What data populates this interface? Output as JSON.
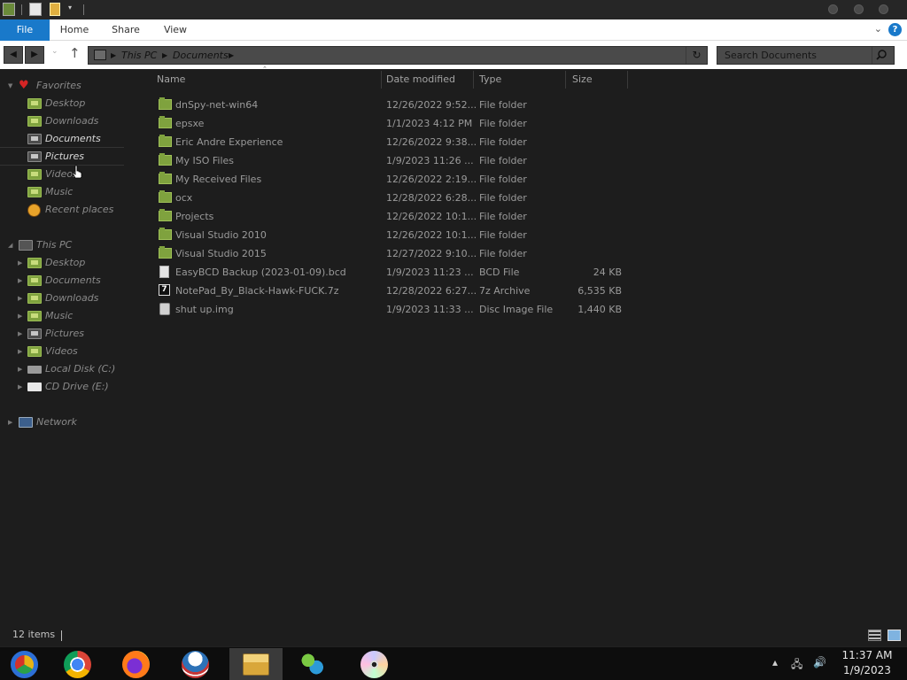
{
  "ribbon": {
    "tabs": [
      "File",
      "Home",
      "Share",
      "View"
    ]
  },
  "address": {
    "crumbs": [
      "This PC",
      "Documents"
    ]
  },
  "search": {
    "placeholder": "Search Documents"
  },
  "navpane": {
    "favorites_label": "Favorites",
    "favorites": [
      "Desktop",
      "Downloads",
      "Documents",
      "Pictures",
      "Videos",
      "Music",
      "Recent places"
    ],
    "thispc_label": "This PC",
    "thispc": [
      "Desktop",
      "Documents",
      "Downloads",
      "Music",
      "Pictures",
      "Videos",
      "Local Disk (C:)",
      "CD Drive (E:)"
    ],
    "network_label": "Network"
  },
  "columns": {
    "name": "Name",
    "date": "Date modified",
    "type": "Type",
    "size": "Size"
  },
  "files": [
    {
      "name": "dnSpy-net-win64",
      "date": "12/26/2022 9:52...",
      "type": "File folder",
      "size": "",
      "icon": "folder-icon"
    },
    {
      "name": "epsxe",
      "date": "1/1/2023 4:12 PM",
      "type": "File folder",
      "size": "",
      "icon": "folder-icon"
    },
    {
      "name": "Eric Andre Experience",
      "date": "12/26/2022 9:38...",
      "type": "File folder",
      "size": "",
      "icon": "folder-icon"
    },
    {
      "name": "My ISO Files",
      "date": "1/9/2023 11:26 ...",
      "type": "File folder",
      "size": "",
      "icon": "folder-icon"
    },
    {
      "name": "My Received Files",
      "date": "12/26/2022 2:19...",
      "type": "File folder",
      "size": "",
      "icon": "folder-icon"
    },
    {
      "name": "ocx",
      "date": "12/28/2022 6:28...",
      "type": "File folder",
      "size": "",
      "icon": "folder-icon"
    },
    {
      "name": "Projects",
      "date": "12/26/2022 10:1...",
      "type": "File folder",
      "size": "",
      "icon": "folder-icon"
    },
    {
      "name": "Visual Studio 2010",
      "date": "12/26/2022 10:1...",
      "type": "File folder",
      "size": "",
      "icon": "folder-icon"
    },
    {
      "name": "Visual Studio 2015",
      "date": "12/27/2022 9:10...",
      "type": "File folder",
      "size": "",
      "icon": "folder-icon"
    },
    {
      "name": "EasyBCD Backup (2023-01-09).bcd",
      "date": "1/9/2023 11:23 ...",
      "type": "BCD File",
      "size": "24 KB",
      "icon": "file-icon"
    },
    {
      "name": "NotePad_By_Black-Hawk-FUCK.7z",
      "date": "12/28/2022 6:27...",
      "type": "7z Archive",
      "size": "6,535 KB",
      "icon": "archive-7z-icon"
    },
    {
      "name": "shut up.img",
      "date": "1/9/2023 11:33 ...",
      "type": "Disc Image File",
      "size": "1,440 KB",
      "icon": "disc-image-icon"
    }
  ],
  "status": {
    "item_count": "12 items"
  },
  "clock": {
    "time": "11:37 AM",
    "date": "1/9/2023"
  },
  "taskbar_apps": [
    "chrome-canary-icon",
    "chrome-icon",
    "firefox-icon",
    "obama-logo-icon",
    "file-explorer-icon",
    "messenger-icon",
    "dvd-icon"
  ],
  "colors": {
    "accent": "#1979ca",
    "background": "#1d1d1d",
    "folder": "#7fa23e"
  }
}
